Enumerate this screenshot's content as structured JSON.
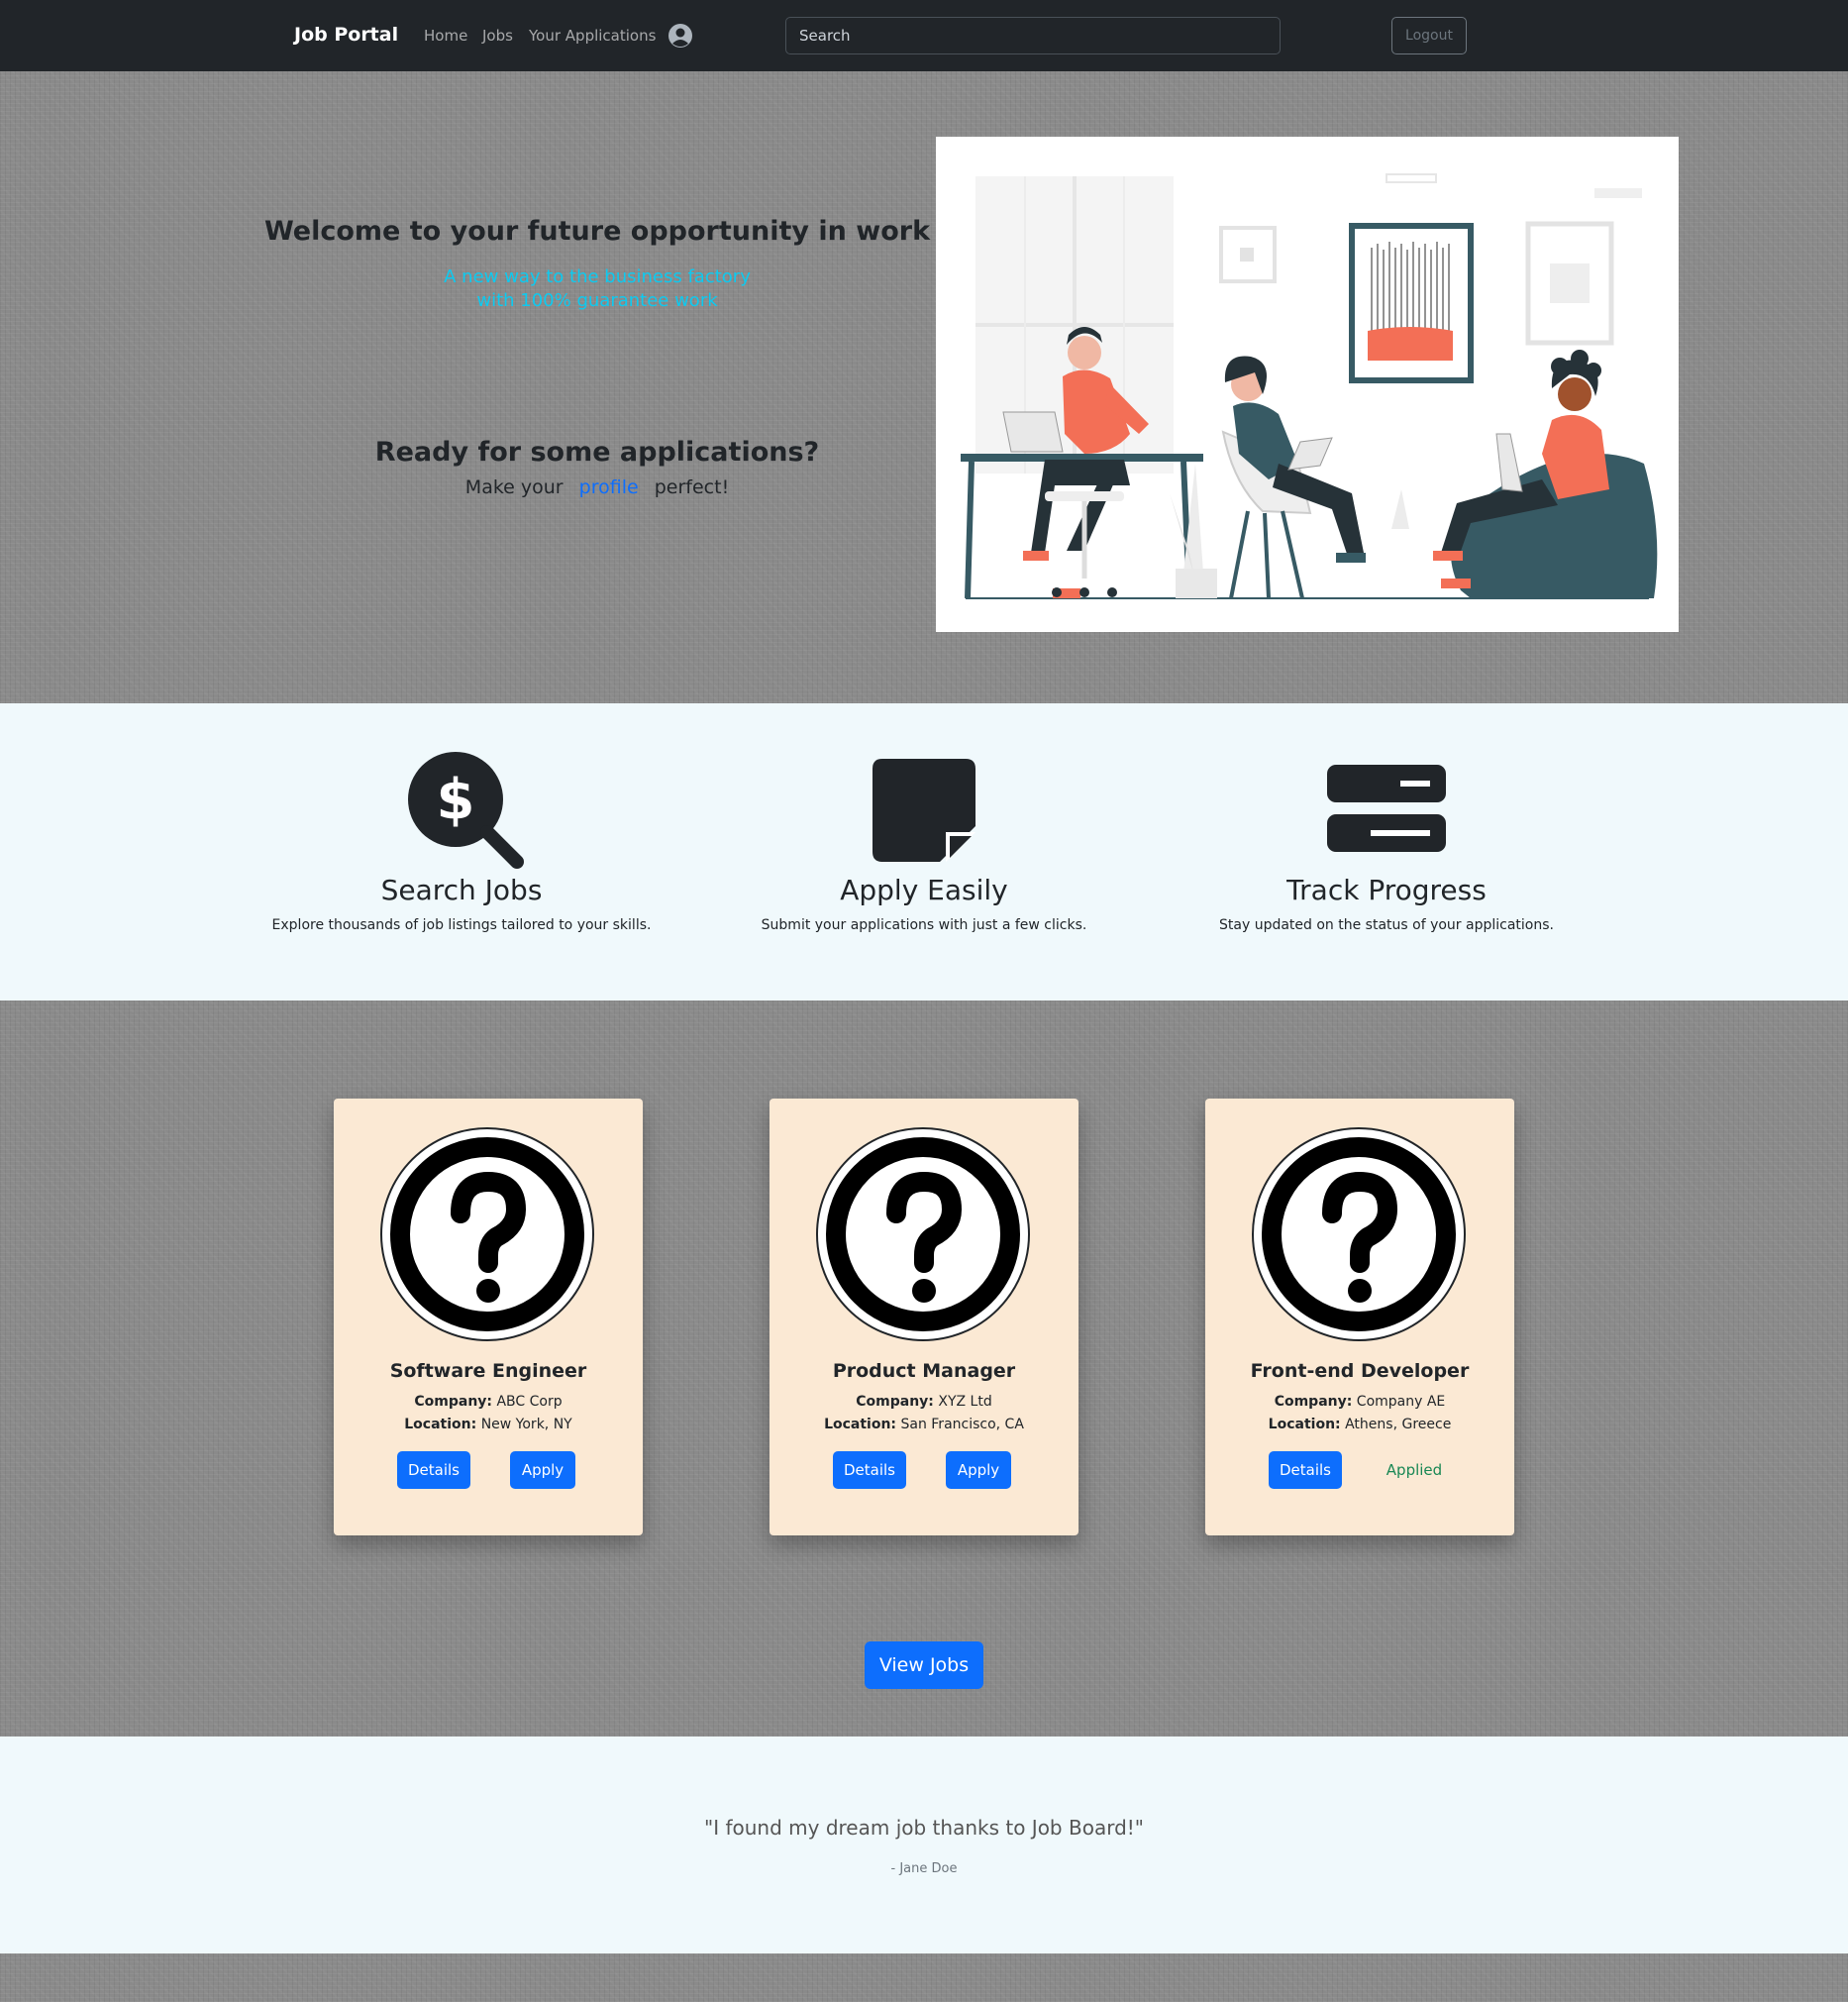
{
  "navbar": {
    "brand": "Job Portal",
    "links": [
      "Home",
      "Jobs",
      "Your Applications"
    ],
    "avatar_icon": "user-circle-icon",
    "search_placeholder": "Search",
    "logout_label": "Logout"
  },
  "hero": {
    "title": "Welcome to your future opportunity in work",
    "subtitle_line1": "A new way to the business factory",
    "subtitle_line2": "with 100% guarantee work",
    "question": "Ready for some applications?",
    "cta_prefix": "Make your",
    "cta_link": "profile",
    "cta_suffix": "perfect!"
  },
  "features": [
    {
      "icon": "search-dollar-icon",
      "title": "Search Jobs",
      "description": "Explore thousands of job listings tailored to your skills."
    },
    {
      "icon": "sticky-note-icon",
      "title": "Apply Easily",
      "description": "Submit your applications with just a few clicks."
    },
    {
      "icon": "server-icon",
      "title": "Track Progress",
      "description": "Stay updated on the status of your applications."
    }
  ],
  "jobs": [
    {
      "title": "Software Engineer",
      "company_label": "Company:",
      "company": "ABC Corp",
      "location_label": "Location:",
      "location": "New York, NY",
      "details_label": "Details",
      "action_label": "Apply",
      "status": "apply"
    },
    {
      "title": "Product Manager",
      "company_label": "Company:",
      "company": "XYZ Ltd",
      "location_label": "Location:",
      "location": "San Francisco, CA",
      "details_label": "Details",
      "action_label": "Apply",
      "status": "apply"
    },
    {
      "title": "Front-end Developer",
      "company_label": "Company:",
      "company": "Company AE",
      "location_label": "Location:",
      "location": "Athens, Greece",
      "details_label": "Details",
      "action_label": "Applied",
      "status": "applied"
    }
  ],
  "view_jobs_label": "View Jobs",
  "testimonial": {
    "quote": "\"I found my dream job thanks to Job Board!\"",
    "author": "- Jane Doe"
  },
  "colors": {
    "navbar": "#212529",
    "primary": "#0d6efd",
    "accent_cyan": "#0dcaf0",
    "card_bg": "#fbe9d4",
    "section_bg": "#f0f9fc",
    "success": "#198754",
    "illustration_orange": "#f36f56",
    "illustration_teal": "#375a64"
  }
}
